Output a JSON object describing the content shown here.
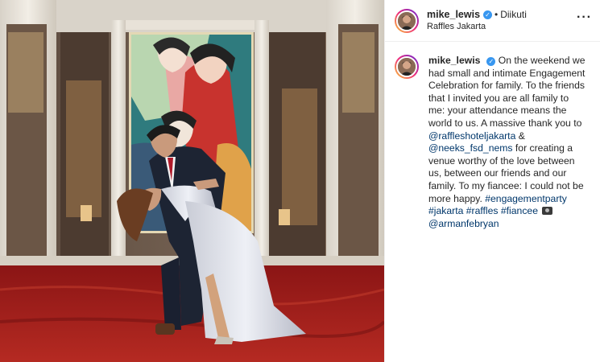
{
  "header": {
    "username": "mike_lewis",
    "verified": true,
    "separator": "•",
    "follow_status": "Diikuti",
    "location": "Raffles Jakarta",
    "more_icon": "more-horizontal-icon"
  },
  "caption": {
    "username": "mike_lewis",
    "verified": true,
    "text_1": "On the weekend we had small and intimate Engagement Celebration for family. To the friends that I invited you are all family to me: your attendance means the world to us. A massive thank you to",
    "mention_1": "@raffleshoteljakarta",
    "amp": " & ",
    "mention_2": "@neeks_fsd_nems",
    "text_2": " for creating a venue worthy of the love between us, between our friends and our family. To my fiancee: I could not be more happy.",
    "hashtags": [
      "#engagementparty",
      "#jakarta",
      "#raffles",
      "#fiancee"
    ],
    "camera_icon": "camera-emoji-icon",
    "mention_3": "@armanfebryan"
  },
  "colors": {
    "link": "#00376b",
    "verified": "#3897f0",
    "carpet": "#9e1c1c",
    "border": "#efefef"
  }
}
